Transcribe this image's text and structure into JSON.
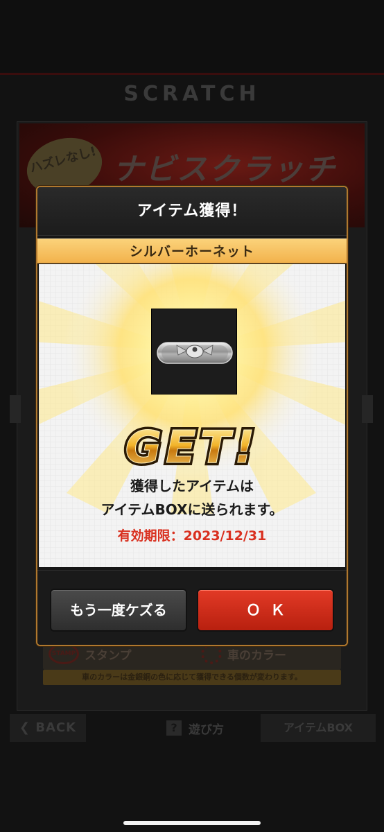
{
  "background": {
    "screen_title": "SCRATCH",
    "banner_title": "ナビスクラッチ",
    "banner_badge": "ハズレなし!",
    "stamp_label": "スタンプ",
    "car_color_label": "車のカラー",
    "note": "車のカラーは金銀銅の色に応じて獲得できる個数が変わります。",
    "back_label": "BACK",
    "howto_label": "遊び方",
    "itembox_label": "アイテムBOX"
  },
  "dialog": {
    "title": "アイテム獲得！",
    "item_name": "シルバーホーネット",
    "get_label": "GET!",
    "message_line1": "獲得したアイテムは",
    "message_line2": "アイテムBOXに送られます。",
    "expiry_label": "有効期限：2023/12/31",
    "retry_button": "もう一度ケズる",
    "ok_button": "ＯＫ"
  },
  "colors": {
    "accent_gold": "#f2b24c",
    "ok_red": "#d12a17",
    "expiry_red": "#d9301f",
    "border_gold": "#b0782e"
  },
  "icons": {
    "item_image": "silver-hornet-emblem",
    "back": "chevron-left-icon",
    "howto": "question-mark-icon",
    "stamp": "stamp-icon",
    "car_color": "gear-icon"
  }
}
